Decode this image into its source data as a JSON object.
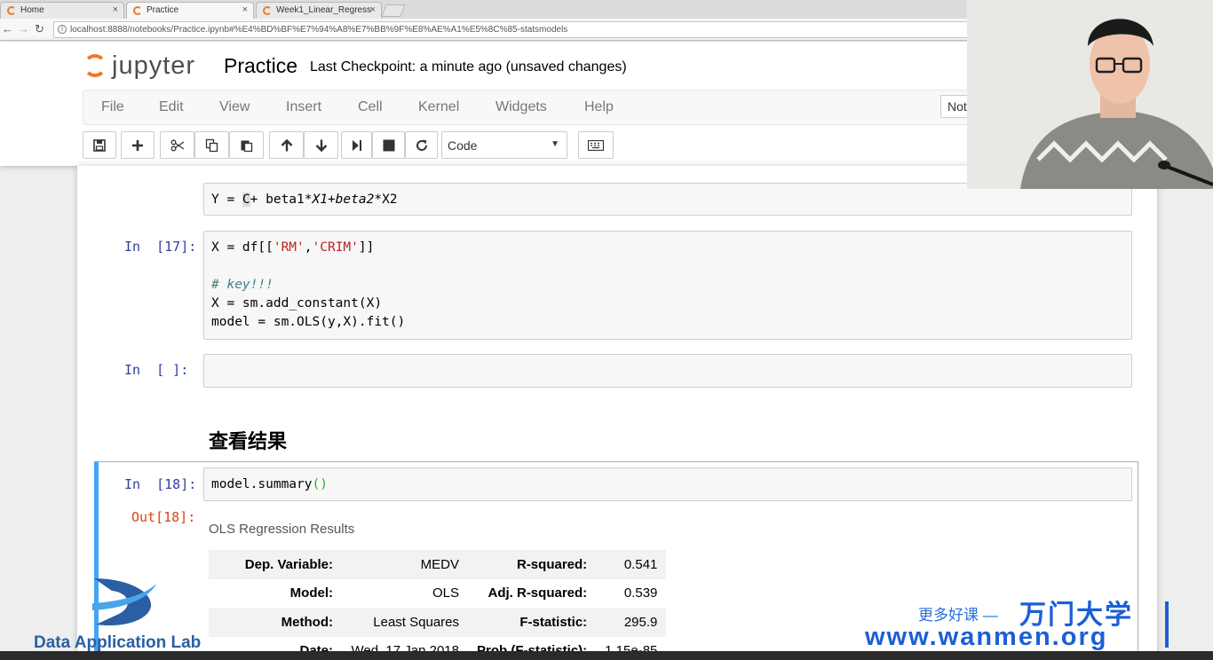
{
  "browser": {
    "tabs": [
      {
        "title": "Home"
      },
      {
        "title": "Practice"
      },
      {
        "title": "Week1_Linear_Regress"
      }
    ],
    "url": "localhost:8888/notebooks/Practice.ipynb#%E4%BD%BF%E7%94%A8%E7%BB%9F%E8%AE%A1%E5%8C%85-statsmodels",
    "tab_close_glyph": "×"
  },
  "jupyter": {
    "logo_text": "jupyter",
    "notebook_name": "Practice",
    "checkpoint": "Last Checkpoint: a minute ago (unsaved changes)",
    "menu": [
      "File",
      "Edit",
      "View",
      "Insert",
      "Cell",
      "Kernel",
      "Widgets",
      "Help"
    ],
    "kernel_indicator": "Not",
    "cell_type": "Code"
  },
  "cells": {
    "formula": {
      "pre": "Y = ",
      "cursor": "C",
      "mid": "+ beta1",
      "ital": "*X1+beta2*",
      "post": "X2"
    },
    "c17": {
      "prompt": "In  [17]:",
      "line1_pre": "X = df[[",
      "s1": "'RM'",
      "comma": ",",
      "s2": "'CRIM'",
      "line1_post": "]]",
      "comment": "# key!!!",
      "line3": "X = sm.add_constant(X)",
      "line4": "model = sm.OLS(y,X).fit()"
    },
    "empty": {
      "prompt": "In  [ ]:"
    },
    "heading": "查看结果",
    "c18": {
      "prompt": "In  [18]:",
      "code": "model.summary",
      "parens": "()",
      "out_prompt": "Out[18]:"
    }
  },
  "output": {
    "title": "OLS Regression Results",
    "rows": [
      {
        "k1": "Dep. Variable:",
        "v1": "MEDV",
        "k2": "R-squared:",
        "v2": "0.541"
      },
      {
        "k1": "Model:",
        "v1": "OLS",
        "k2": "Adj. R-squared:",
        "v2": "0.539"
      },
      {
        "k1": "Method:",
        "v1": "Least Squares",
        "k2": "F-statistic:",
        "v2": "295.9"
      },
      {
        "k1": "Date:",
        "v1": "Wed, 17 Jan 2018",
        "k2": "Prob (F-statistic):",
        "v2": "1.15e-85"
      }
    ]
  },
  "watermarks": {
    "lab": "Data Application Lab",
    "tagline": "更多好课 —",
    "brand": "万门大学",
    "url": "www.wanmen.org"
  },
  "colors": {
    "jupyter_orange": "#f37726",
    "input_prompt": "#303f9f",
    "output_prompt": "#d84315",
    "selected_cell_border": "#42a5f5",
    "wanmen_blue": "#1b5fd6"
  }
}
